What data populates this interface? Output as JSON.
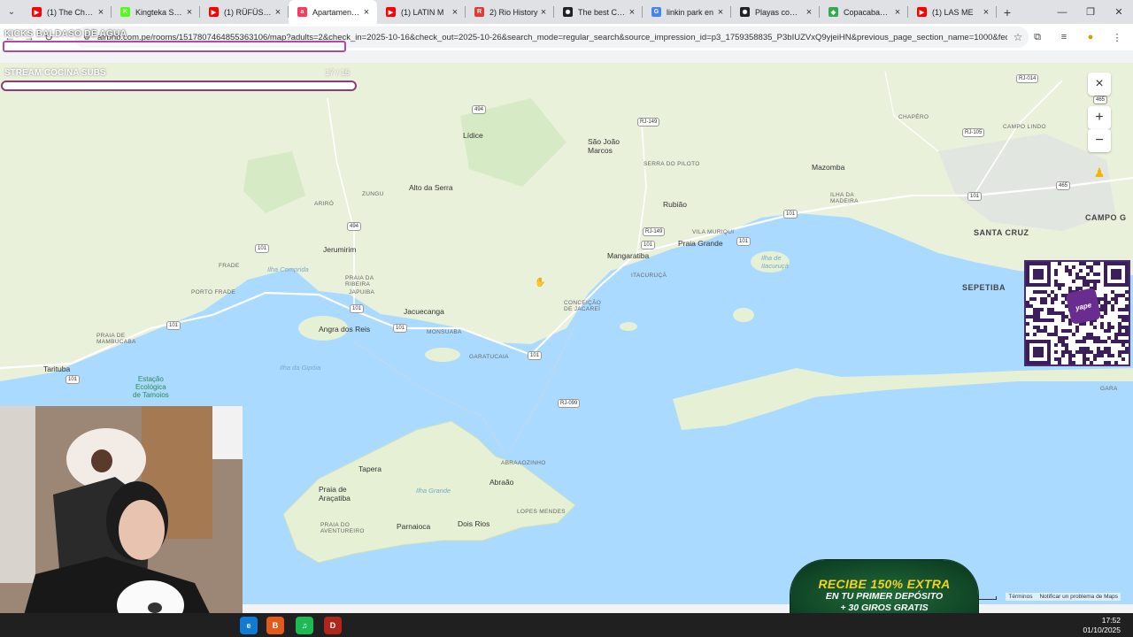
{
  "browser": {
    "tabs": [
      {
        "title": "(1) The Chemic",
        "favicon_color": "#ff0000",
        "favicon_glyph": "▶",
        "active": false
      },
      {
        "title": "Kingteka Strea",
        "favicon_color": "#53fc18",
        "favicon_glyph": "K",
        "active": false
      },
      {
        "title": "(1) RÜFÜS DU",
        "favicon_color": "#ff0000",
        "favicon_glyph": "▶",
        "active": false
      },
      {
        "title": "Apartamento c",
        "favicon_color": "#ff385c",
        "favicon_glyph": "a",
        "active": true
      },
      {
        "title": "(1) LATIN M",
        "favicon_color": "#ff0000",
        "favicon_glyph": "▶",
        "active": false
      },
      {
        "title": "2) Rio History",
        "favicon_color": "#e53935",
        "favicon_glyph": "R",
        "active": false
      },
      {
        "title": "The best ChatG",
        "favicon_color": "#202123",
        "favicon_glyph": "✺",
        "active": false
      },
      {
        "title": "linkin park en",
        "favicon_color": "#4285f4",
        "favicon_glyph": "G",
        "active": false
      },
      {
        "title": "Playas comune",
        "favicon_color": "#202123",
        "favicon_glyph": "✺",
        "active": false
      },
      {
        "title": "Copacabana -",
        "favicon_color": "#34a853",
        "favicon_glyph": "◈",
        "active": false
      },
      {
        "title": "(1) LAS ME",
        "favicon_color": "#ff0000",
        "favicon_glyph": "▶",
        "active": false
      }
    ],
    "new_tab_label": "+",
    "url": "airbnb.com.pe/rooms/1517807464855363106/map?adults=2&check_in=2025-10-16&check_out=2025-10-26&search_mode=regular_search&source_impression_id=p3_1759358835_P3bIUZVxQ9yjeiHN&previous_page_section_name=1000&federate..."
  },
  "overlays": {
    "follow_goal_label": "KICKS BALDASO DE AGUA",
    "follow_goal_progress": 0.06,
    "sub_goal_label": "STREAM COCINA SUBS",
    "sub_goal_count": "17 / 15"
  },
  "map": {
    "labels": [
      {
        "text": "Lídice",
        "cls": "town"
      },
      {
        "text": "São João\nMarcos",
        "cls": "town"
      },
      {
        "text": "SERRA DO PILOTO",
        "cls": "caps"
      },
      {
        "text": "Alto da Serra",
        "cls": "town"
      },
      {
        "text": "ZUNGU",
        "cls": "caps"
      },
      {
        "text": "ARIRÓ",
        "cls": "caps"
      },
      {
        "text": "Rubião",
        "cls": "town"
      },
      {
        "text": "CHAPÉRO",
        "cls": "caps"
      },
      {
        "text": "Mazomba",
        "cls": "town"
      },
      {
        "text": "CAMPO LINDO",
        "cls": "caps"
      },
      {
        "text": "ILHA DA\nMADEIRA",
        "cls": "caps"
      },
      {
        "text": "VILA MURIQUI",
        "cls": "caps"
      },
      {
        "text": "Praia Grande",
        "cls": "town"
      },
      {
        "text": "Mangaratiba",
        "cls": "town"
      },
      {
        "text": "Jerumirim",
        "cls": "town"
      },
      {
        "text": "Ilha Comprida",
        "cls": "water"
      },
      {
        "text": "FRADE",
        "cls": "caps"
      },
      {
        "text": "PORTO FRADE",
        "cls": "caps"
      },
      {
        "text": "PRAIA DA\nRIBEIRA",
        "cls": "caps"
      },
      {
        "text": "JAPUIBA",
        "cls": "caps"
      },
      {
        "text": "Jacuecanga",
        "cls": "town"
      },
      {
        "text": "Angra dos Reis",
        "cls": "town"
      },
      {
        "text": "MONSUABA",
        "cls": "caps"
      },
      {
        "text": "CONCEIÇÃO\nDE JACAREÍ",
        "cls": "caps"
      },
      {
        "text": "ITACURUÇÁ",
        "cls": "caps"
      },
      {
        "text": "Ilha de\nItacuruçá",
        "cls": "water"
      },
      {
        "text": "SANTA CRUZ",
        "cls": "big"
      },
      {
        "text": "SEPETIBA",
        "cls": "big"
      },
      {
        "text": "CAMPO G",
        "cls": "big"
      },
      {
        "text": "PRAIA DE\nMAMBUCABA",
        "cls": "caps"
      },
      {
        "text": "Tarituba",
        "cls": "town"
      },
      {
        "text": "Estação\nEcológica\nde Tamoios",
        "cls": "park"
      },
      {
        "text": "Ilha da Gipóia",
        "cls": "water"
      },
      {
        "text": "GARATUCAIA",
        "cls": "caps"
      },
      {
        "text": "ABRAAOZINHO",
        "cls": "caps"
      },
      {
        "text": "Abraão",
        "cls": "town"
      },
      {
        "text": "Tapera",
        "cls": "town"
      },
      {
        "text": "Ilha Grande",
        "cls": "water"
      },
      {
        "text": "Praia de\nAraçatiba",
        "cls": "town"
      },
      {
        "text": "LOPES MENDES",
        "cls": "caps"
      },
      {
        "text": "PRAIA DO\nAVENTUREIRO",
        "cls": "caps"
      },
      {
        "text": "Parnaioca",
        "cls": "town"
      },
      {
        "text": "Dois Rios",
        "cls": "town"
      },
      {
        "text": "GARA",
        "cls": "caps"
      }
    ],
    "road_shields": [
      "494",
      "494",
      "RJ-149",
      "RJ-149",
      "101",
      "101",
      "101",
      "101",
      "101",
      "101",
      "101",
      "101",
      "101",
      "101",
      "RJ-014",
      "465",
      "465",
      "RJ-105",
      "RJ-099"
    ],
    "zoom_in_label": "+",
    "zoom_out_label": "−",
    "close_label": "×",
    "attribution_terms": "Términos",
    "attribution_report": "Notificar un problema de Maps",
    "colors": {
      "land": "#e9f1da",
      "water": "#aadaff",
      "forest": "#d3e8c4"
    }
  },
  "qr": {
    "brand": "yape"
  },
  "promo": {
    "line1": "RECIBE 150% EXTRA",
    "line2": "EN TU PRIMER DEPÓSITO",
    "line3": "+ 30 GIROS GRATIS"
  },
  "taskbar": {
    "apps": [
      {
        "name": "edge",
        "glyph": "e",
        "color": "#0f7bd6"
      },
      {
        "name": "brave",
        "glyph": "B",
        "color": "#e25a1c"
      },
      {
        "name": "spotify",
        "glyph": "♫",
        "color": "#1db954"
      },
      {
        "name": "dota",
        "glyph": "D",
        "color": "#b0261b"
      }
    ],
    "time": "17:52",
    "date": "01/10/2025"
  }
}
